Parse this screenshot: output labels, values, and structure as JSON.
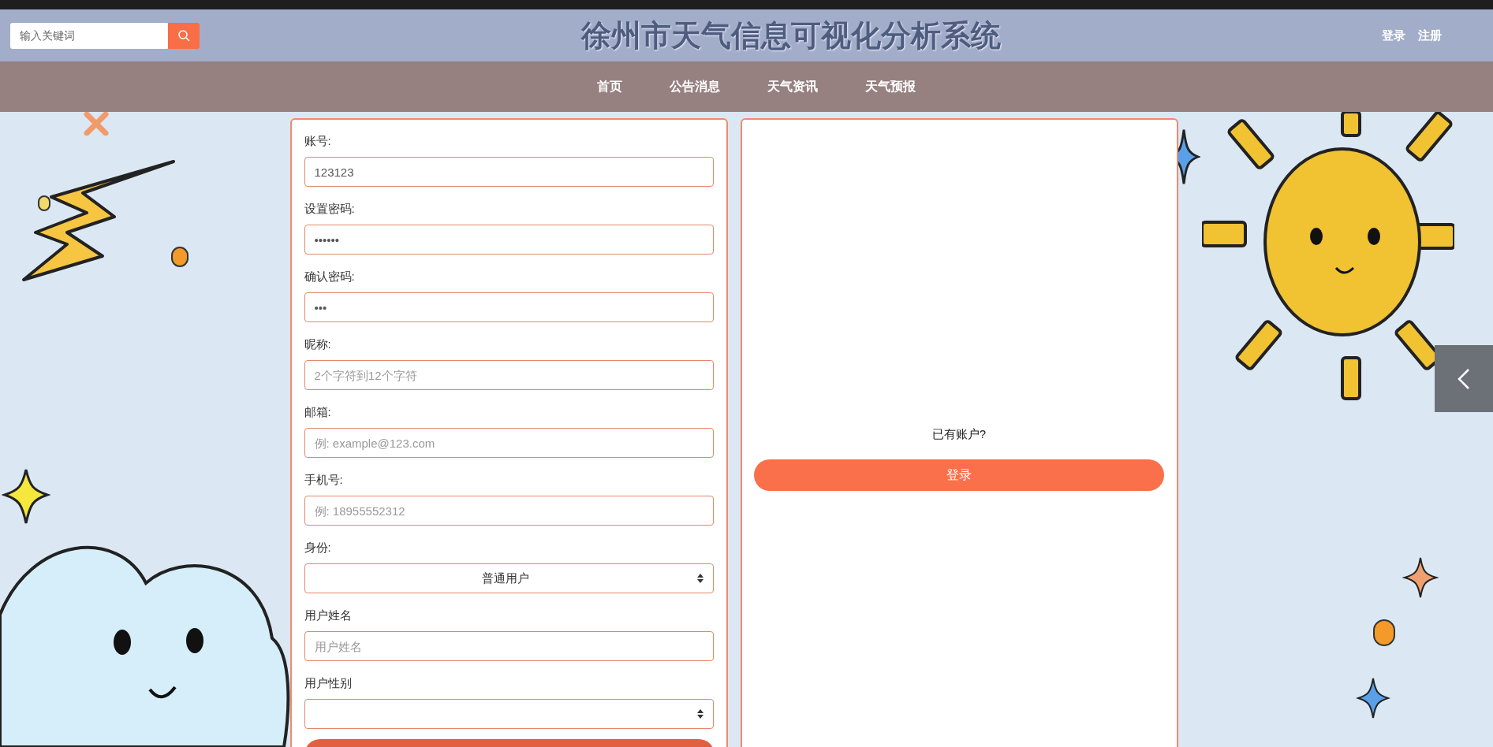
{
  "header": {
    "search": {
      "placeholder": "输入关键词"
    },
    "title": "徐州市天气信息可视化分析系统",
    "links": [
      "登录",
      "注册"
    ]
  },
  "nav": {
    "items": [
      {
        "label": "首页"
      },
      {
        "label": "公告消息"
      },
      {
        "label": "天气资讯"
      },
      {
        "label": "天气预报"
      }
    ]
  },
  "register_form": {
    "fields": [
      {
        "kind": "text",
        "label": "账号:",
        "value": "123123"
      },
      {
        "kind": "password",
        "label": "设置密码:",
        "value": "••••••"
      },
      {
        "kind": "password",
        "label": "确认密码:",
        "value": "•••"
      },
      {
        "kind": "text",
        "label": "昵称:",
        "placeholder": "2个字符到12个字符"
      },
      {
        "kind": "text",
        "label": "邮箱:",
        "placeholder": "例: example@123.com"
      },
      {
        "kind": "text",
        "label": "手机号:",
        "placeholder": "例: 18955552312"
      },
      {
        "kind": "select",
        "label": "身份:",
        "value": "普通用户"
      },
      {
        "kind": "text",
        "label": "用户姓名",
        "placeholder": "用户姓名"
      },
      {
        "kind": "select",
        "label": "用户性别"
      }
    ]
  },
  "login_panel": {
    "prompt": "已有账户?",
    "button": "登录"
  }
}
